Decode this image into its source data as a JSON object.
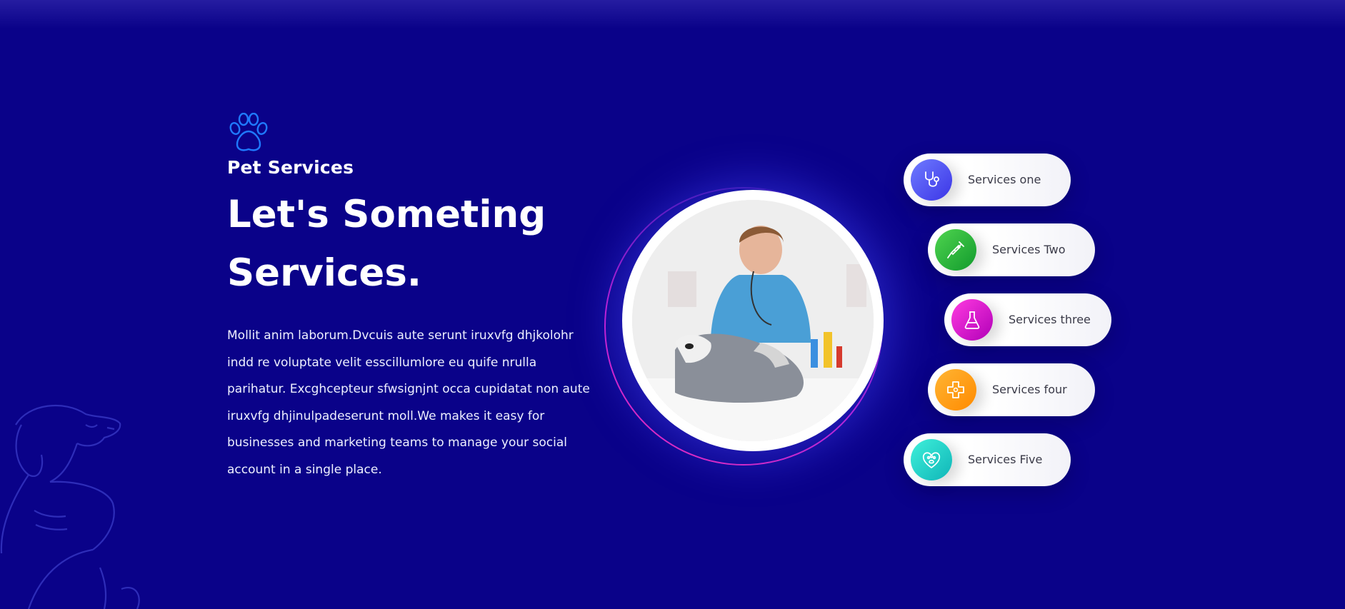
{
  "hero": {
    "eyebrow": "Pet Services",
    "headline_line1": "Let's Someting",
    "headline_line2": "Services.",
    "body": "Mollit anim laborum.Dvcuis aute serunt iruxvfg dhjkolohr indd re voluptate velit esscillumlore eu quife nrulla parihatur. Excghcepteur sfwsignjnt occa cupidatat non aute iruxvfg dhjinulpadeserunt moll.We makes it easy for businesses and marketing teams to manage your social account in a single place."
  },
  "services": [
    {
      "label": "Services one",
      "icon": "stethoscope-icon",
      "colors": [
        "#6f7bff",
        "#3b35e6"
      ]
    },
    {
      "label": "Services Two",
      "icon": "syringe-icon",
      "colors": [
        "#4fd44f",
        "#119a2d"
      ]
    },
    {
      "label": "Services three",
      "icon": "flask-icon",
      "colors": [
        "#ff3be0",
        "#b100b8"
      ]
    },
    {
      "label": "Services four",
      "icon": "medical-cross-icon",
      "colors": [
        "#ffb533",
        "#ff8a00"
      ]
    },
    {
      "label": "Services Five",
      "icon": "heart-paw-icon",
      "colors": [
        "#3ff0da",
        "#0fb5b8"
      ]
    }
  ],
  "colors": {
    "background": "#0a0289",
    "paw_icon": "#1f7aff"
  }
}
